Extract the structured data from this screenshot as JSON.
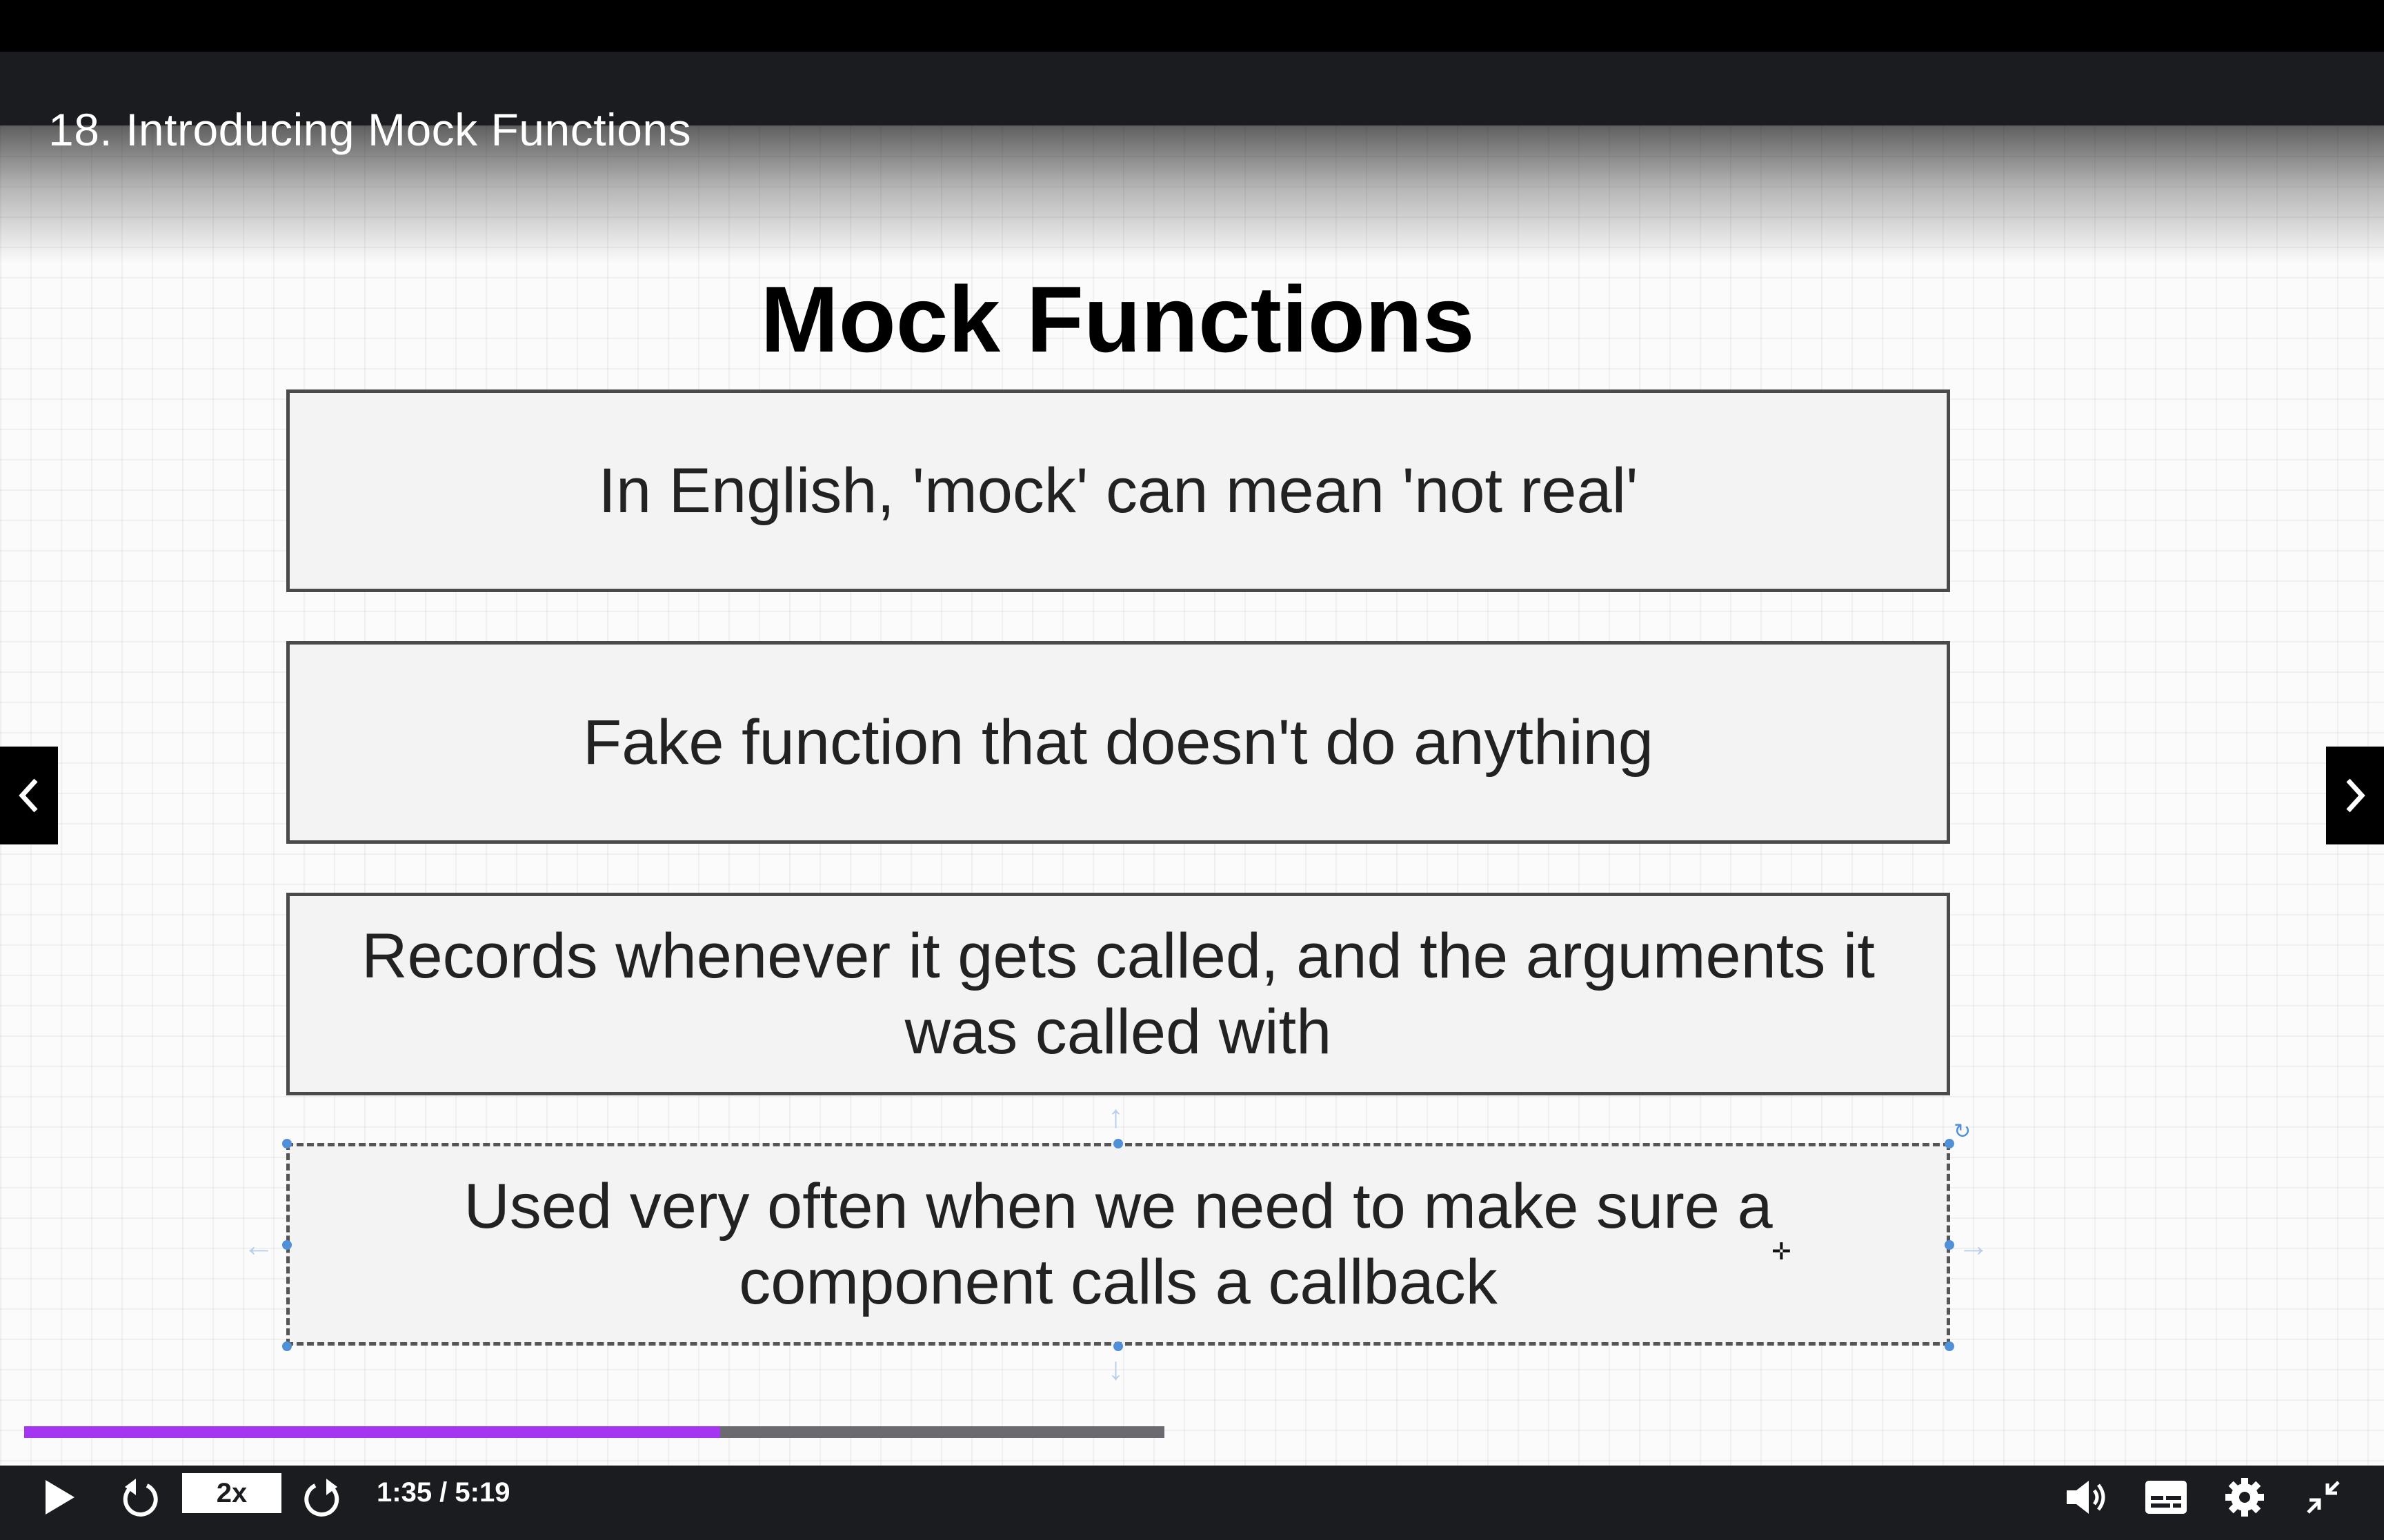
{
  "lecture": {
    "title": "18. Introducing Mock Functions"
  },
  "slide": {
    "heading": "Mock Functions",
    "cards": [
      {
        "lines": [
          "In English, 'mock' can mean 'not real'"
        ]
      },
      {
        "lines": [
          "Fake function that doesn't do anything"
        ]
      },
      {
        "lines": [
          "Records whenever it gets called, and the arguments it",
          "was called with"
        ]
      },
      {
        "lines": [
          "Used very often when we need to make sure a",
          "component calls a callback"
        ],
        "selected": true
      }
    ]
  },
  "player": {
    "speed": "2x",
    "current_time": "1:35",
    "duration": "5:19",
    "time_display": "1:35 / 5:19",
    "progress_fraction": 0.298,
    "accent_color": "#a435f0"
  },
  "icons": {
    "play": "play-icon",
    "rewind": "rewind-icon",
    "forward": "forward-icon",
    "volume": "volume-icon",
    "captions": "captions-icon",
    "settings": "gear-icon",
    "exit_fullscreen": "exit-fullscreen-icon",
    "prev": "chevron-left-icon",
    "next": "chevron-right-icon"
  }
}
